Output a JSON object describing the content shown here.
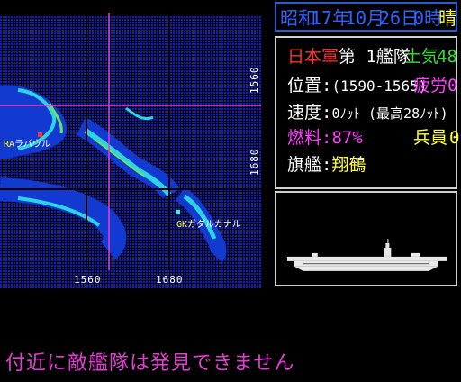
{
  "date": {
    "era": "昭和",
    "year": "17年",
    "month": "10月",
    "day": "26日",
    "hour": "0時",
    "weather": "晴"
  },
  "fleet": {
    "side": "日本軍",
    "name": "第 1艦隊",
    "morale_label": "士気",
    "morale_value": "48",
    "position_label": "位置:",
    "position_value": "(1590-1565)",
    "fatigue_label": "疲労",
    "fatigue_value": "0",
    "speed_label": "速度:",
    "speed_value": "0ﾉｯﾄ (最高28ﾉｯﾄ)",
    "fuel_label": "燃料:",
    "fuel_value": "87%",
    "troops_label": "兵員",
    "troops_value": "0",
    "flagship_label": "旗艦:",
    "flagship_value": "翔鶴"
  },
  "map": {
    "grid_x_labels": [
      "1560",
      "1680"
    ],
    "grid_y_labels": [
      "1560",
      "1680"
    ],
    "bases": [
      {
        "code": "RA",
        "name": "ラバウル"
      },
      {
        "code": "GK",
        "name": "ガダルカナル"
      }
    ]
  },
  "message": "付近に敵艦隊は発見できません",
  "colors": {
    "sea": "#0a1aa0",
    "land": "#2bd4e0",
    "cursor": "#e040d0",
    "date_text": "#3060ff",
    "weather": "#ffff40",
    "side": "#ff3030",
    "morale": "#30e030",
    "fatigue": "#ff40ff",
    "fuel": "#ff40ff",
    "flagship": "#ffff40"
  },
  "icons": [
    "base-marker-red-icon",
    "base-marker-cyan-icon",
    "aircraft-carrier-silhouette-icon"
  ]
}
